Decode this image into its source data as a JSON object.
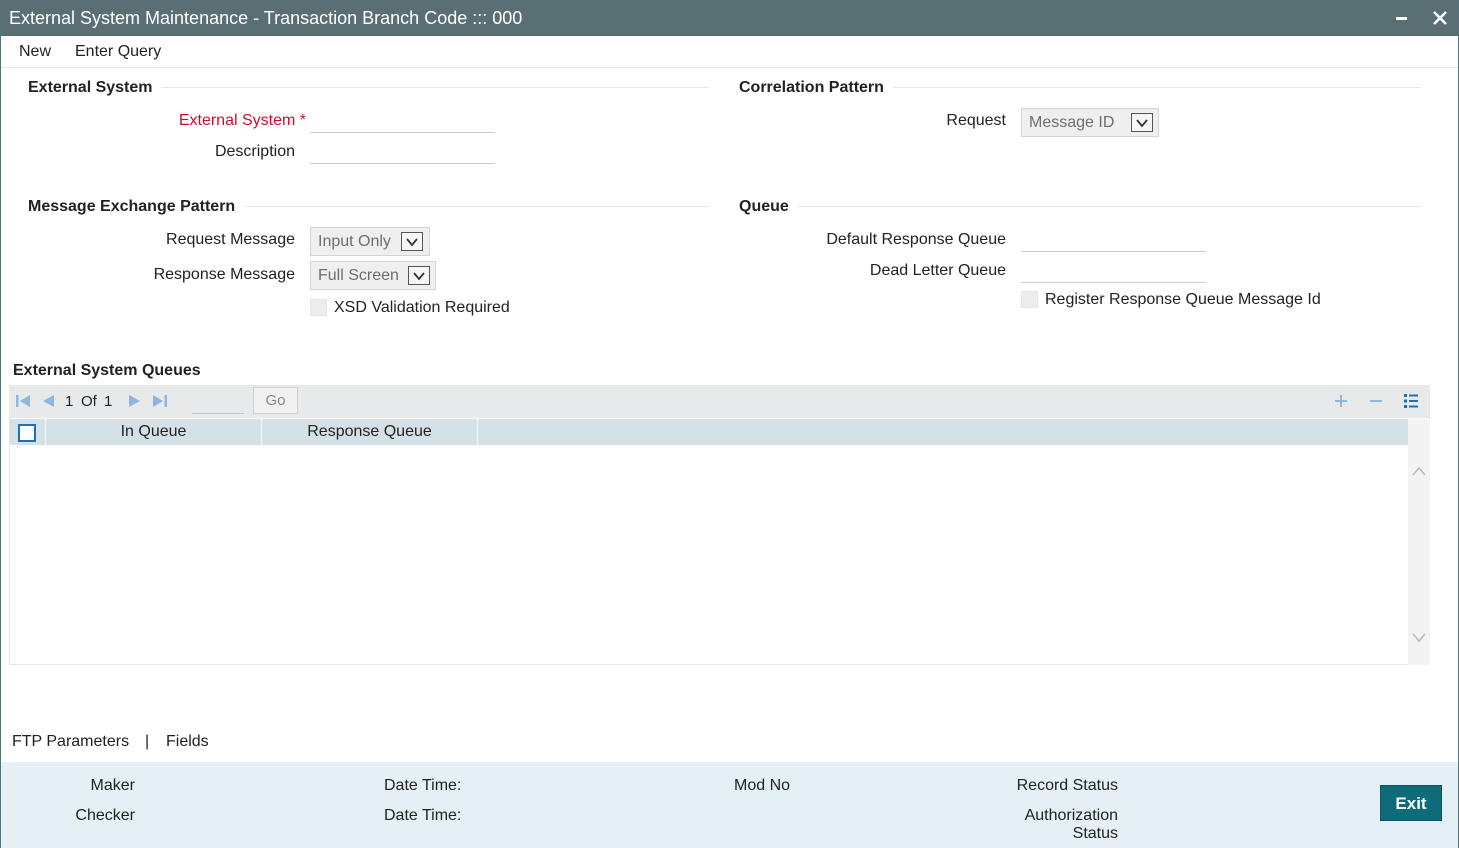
{
  "window": {
    "title": "External System Maintenance - Transaction Branch Code ::: 000"
  },
  "menu": {
    "new_label": "New",
    "enter_query_label": "Enter Query"
  },
  "external_system": {
    "heading": "External System",
    "external_system_label": "External System",
    "required_mark": "*",
    "external_system_value": "",
    "description_label": "Description",
    "description_value": ""
  },
  "correlation_pattern": {
    "heading": "Correlation Pattern",
    "request_label": "Request",
    "request_value": "Message ID"
  },
  "message_exchange_pattern": {
    "heading": "Message Exchange Pattern",
    "request_message_label": "Request Message",
    "request_message_value": "Input Only",
    "response_message_label": "Response Message",
    "response_message_value": "Full Screen",
    "xsd_validation_label": "XSD Validation Required",
    "xsd_validation_checked": false
  },
  "queue": {
    "heading": "Queue",
    "default_response_queue_label": "Default Response Queue",
    "default_response_queue_value": "",
    "dead_letter_queue_label": "Dead Letter Queue",
    "dead_letter_queue_value": "",
    "register_response_label": "Register Response Queue Message Id",
    "register_response_checked": false
  },
  "external_system_queues": {
    "heading": "External System Queues",
    "pager": {
      "current_page": "1",
      "of_label": "Of",
      "total_pages": "1",
      "go_label": "Go"
    },
    "columns": [
      "In Queue",
      "Response Queue"
    ],
    "rows": []
  },
  "tabs": {
    "ftp_parameters": "FTP Parameters",
    "separator": "|",
    "fields": "Fields"
  },
  "footer": {
    "maker_label": "Maker",
    "checker_label": "Checker",
    "date_time_label_1": "Date Time:",
    "date_time_label_2": "Date Time:",
    "mod_no_label": "Mod No",
    "record_status_label": "Record Status",
    "authorization_label_1": "Authorization",
    "authorization_label_2": "Status",
    "exit_label": "Exit"
  },
  "colors": {
    "titlebar": "#5a6f74",
    "required": "#c8102e",
    "grid_header": "#d4e2e7",
    "footer": "#e4f0f3",
    "exit_button": "#0f6b7a",
    "pager_icon": "#8fb6df"
  },
  "icons": {
    "minimize": "minimize-icon",
    "close": "close-icon",
    "first_page": "first-page-icon",
    "prev_page": "prev-page-icon",
    "next_page": "next-page-icon",
    "last_page": "last-page-icon",
    "add_row": "plus-icon",
    "delete_row": "minus-icon",
    "view_list": "list-view-icon",
    "dropdown": "chevron-down-icon",
    "scroll_up": "chevron-up-icon",
    "scroll_down": "chevron-down-icon"
  }
}
